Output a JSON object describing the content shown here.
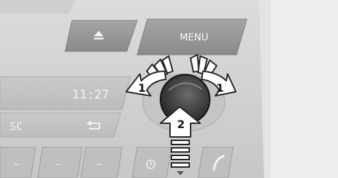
{
  "menu_button": {
    "label": "MENU"
  },
  "eject_button": {
    "icon": "eject-icon"
  },
  "display": {
    "clock": "11:27",
    "source_label": "SC",
    "back_icon": "back-arrow-icon"
  },
  "callouts": {
    "rotate_left": "1",
    "rotate_right": "1",
    "press": "2"
  },
  "bottom_row": {
    "button_1": "–",
    "button_2": "–",
    "button_3": "–",
    "clock_icon": "clock-icon",
    "phone_icon": "phone-icon"
  },
  "colors": {
    "panel": "#d6d6d6",
    "panel_dark": "#bdbdbd",
    "button_dark": "#8f8f8f",
    "text_light": "#f7f7f7",
    "arrow_fill": "#ffffff",
    "arrow_stroke": "#222222"
  }
}
